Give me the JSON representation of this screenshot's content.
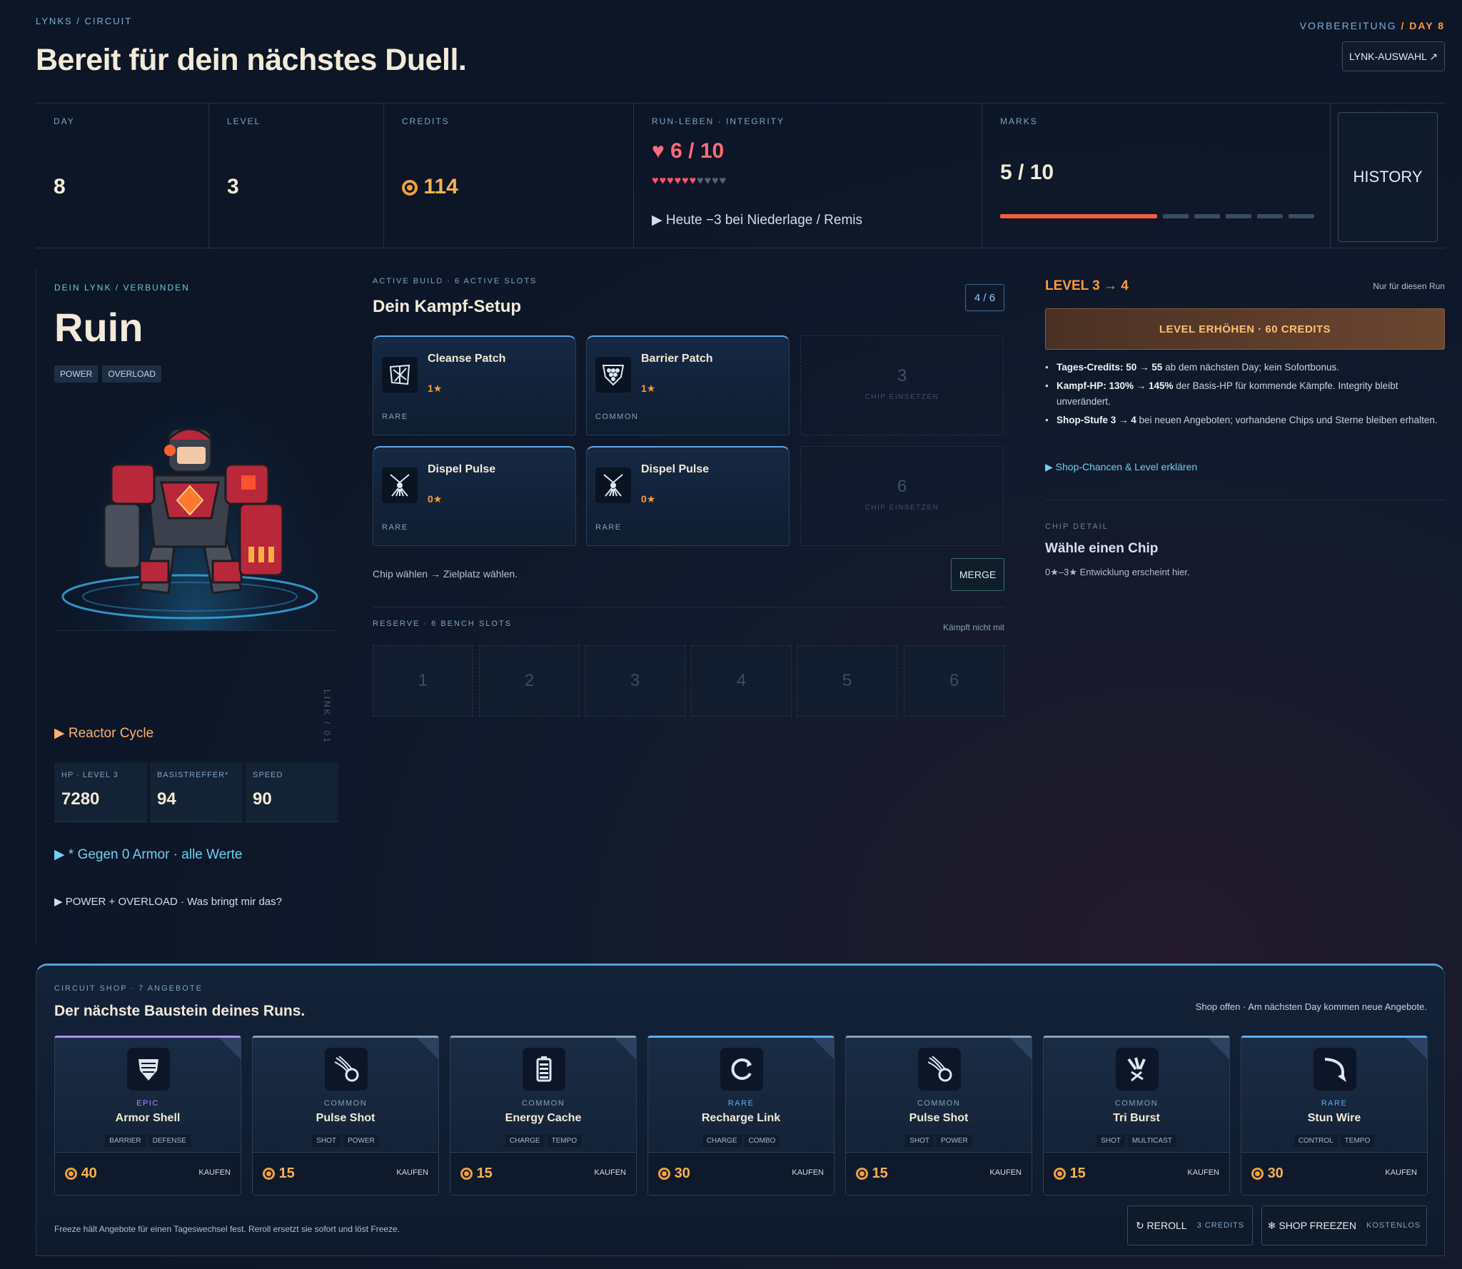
{
  "header": {
    "breadcrumb": "LYNKS / CIRCUIT",
    "title": "Bereit für dein nächstes Duell.",
    "phase_label": "VORBEREITUNG",
    "phase_day": "/ DAY 8",
    "lynk_button": "LYNK-AUSWAHL ↗"
  },
  "stats": {
    "day_label": "DAY",
    "day": "8",
    "level_label": "LEVEL",
    "level": "3",
    "credits_label": "CREDITS",
    "credits": "114",
    "life_label": "RUN-LEBEN · INTEGRITY",
    "life": "♥ 6 / 10",
    "hearts_on": "♥♥♥♥♥♥",
    "hearts_off": "♥♥♥♥",
    "life_note": "▶ Heute −3 bei Niederlage / Remis",
    "marks_label": "MARKS",
    "marks": "5 / 10",
    "marks_progress": 0.5,
    "history_button": "HISTORY"
  },
  "lynk": {
    "label": "DEIN LYNK / VERBUNDEN",
    "name": "Ruin",
    "tags": [
      "POWER",
      "OVERLOAD"
    ],
    "vertical_label": "LINK / 01",
    "reactor": "▶ Reactor Cycle",
    "stats": [
      {
        "label": "HP · LEVEL 3",
        "value": "7280"
      },
      {
        "label": "BASISTREFFER*",
        "value": "94"
      },
      {
        "label": "SPEED",
        "value": "90"
      }
    ],
    "armor_note": "▶ * Gegen 0 Armor · alle Werte",
    "synergy_note": "▶ POWER + OVERLOAD · Was bringt mir das?"
  },
  "build": {
    "label": "ACTIVE BUILD · 6 ACTIVE SLOTS",
    "title": "Dein Kampf-Setup",
    "count": "4 / 6",
    "slots": [
      {
        "name": "Cleanse Patch",
        "stars": "1★",
        "rarity": "RARE",
        "icon": "cleanse-icon"
      },
      {
        "name": "Barrier Patch",
        "stars": "1★",
        "rarity": "COMMON",
        "icon": "barrier-icon"
      },
      {
        "name": "Dispel Pulse",
        "stars": "0★",
        "rarity": "RARE",
        "icon": "dispel-icon"
      },
      {
        "name": "Dispel Pulse",
        "stars": "0★",
        "rarity": "RARE",
        "icon": "dispel-icon"
      }
    ],
    "empty_slots": [
      {
        "number": "3",
        "text": "CHIP EINSETZEN"
      },
      {
        "number": "6",
        "text": "CHIP EINSETZEN"
      }
    ],
    "hint": "Chip wählen → Zielplatz wählen.",
    "merge_button": "MERGE",
    "reserve_label": "RESERVE · 6 BENCH SLOTS",
    "reserve_note": "Kämpft nicht mit",
    "bench": [
      "1",
      "2",
      "3",
      "4",
      "5",
      "6"
    ]
  },
  "levelup": {
    "title": "LEVEL 3 → 4",
    "note": "Nur für diesen Run",
    "button": "LEVEL ERHÖHEN · 60 CREDITS",
    "bullets": [
      {
        "bold": "Tages-Credits: 50 → 55",
        "text": " ab dem nächsten Day; kein Sofortbonus."
      },
      {
        "bold": "Kampf-HP: 130% → 145%",
        "text": " der Basis-HP für kommende Kämpfe. Integrity bleibt unverändert."
      },
      {
        "bold": "Shop-Stufe 3 → 4",
        "text": " bei neuen Angeboten; vorhandene Chips und Sterne bleiben erhalten."
      }
    ],
    "link": "▶ Shop-Chancen & Level erklären"
  },
  "chip_detail": {
    "label": "CHIP DETAIL",
    "title": "Wähle einen Chip",
    "text": "0★–3★ Entwicklung erscheint hier."
  },
  "shop": {
    "label": "CIRCUIT SHOP · 7 ANGEBOTE",
    "title": "Der nächste Baustein deines Runs.",
    "status": "Shop offen · Am nächsten Day kommen neue Angebote.",
    "buy_label": "KAUFEN",
    "items": [
      {
        "rarity": "EPIC",
        "name": "Armor Shell",
        "tags": [
          "BARRIER",
          "DEFENSE"
        ],
        "price": "40",
        "icon": "armor-shield-icon",
        "color": "#b48cff"
      },
      {
        "rarity": "COMMON",
        "name": "Pulse Shot",
        "tags": [
          "SHOT",
          "POWER"
        ],
        "price": "15",
        "icon": "pulse-shot-icon",
        "color": "#8aa0b6"
      },
      {
        "rarity": "COMMON",
        "name": "Energy Cache",
        "tags": [
          "CHARGE",
          "TEMPO"
        ],
        "price": "15",
        "icon": "battery-icon",
        "color": "#8aa0b6"
      },
      {
        "rarity": "RARE",
        "name": "Recharge Link",
        "tags": [
          "CHARGE",
          "COMBO"
        ],
        "price": "30",
        "icon": "recharge-icon",
        "color": "#5ab0f0"
      },
      {
        "rarity": "COMMON",
        "name": "Pulse Shot",
        "tags": [
          "SHOT",
          "POWER"
        ],
        "price": "15",
        "icon": "pulse-shot-icon",
        "color": "#8aa0b6"
      },
      {
        "rarity": "COMMON",
        "name": "Tri Burst",
        "tags": [
          "SHOT",
          "MULTICAST"
        ],
        "price": "15",
        "icon": "tri-burst-icon",
        "color": "#8aa0b6"
      },
      {
        "rarity": "RARE",
        "name": "Stun Wire",
        "tags": [
          "CONTROL",
          "TEMPO"
        ],
        "price": "30",
        "icon": "stun-wire-icon",
        "color": "#5ab0f0"
      }
    ],
    "footer_note": "Freeze hält Angebote für einen Tageswechsel fest. Reroll ersetzt sie sofort und löst Freeze.",
    "reroll_label": "↻ REROLL",
    "reroll_cost": "3 CREDITS",
    "freeze_label": "❄ SHOP FREEZEN",
    "freeze_cost": "KOSTENLOS"
  }
}
